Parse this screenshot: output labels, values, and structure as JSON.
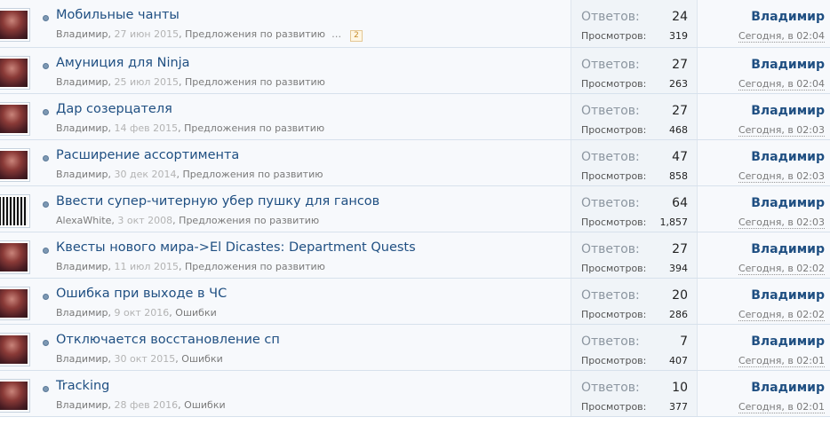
{
  "threads": [
    {
      "title": "Мобильные чанты",
      "author": "Владимир",
      "date": "27 июн 2015",
      "forum": "Предложения по развитию",
      "pages": "2",
      "replies_label": "Ответов:",
      "replies": "24",
      "views_label": "Просмотров:",
      "views": "319",
      "last_user": "Владимир",
      "last_time": "Сегодня, в 02:04"
    },
    {
      "title": "Амуниция для Ninja",
      "author": "Владимир",
      "date": "25 июл 2015",
      "forum": "Предложения по развитию",
      "replies_label": "Ответов:",
      "replies": "27",
      "views_label": "Просмотров:",
      "views": "263",
      "last_user": "Владимир",
      "last_time": "Сегодня, в 02:04"
    },
    {
      "title": "Дар созерцателя",
      "author": "Владимир",
      "date": "14 фев 2015",
      "forum": "Предложения по развитию",
      "replies_label": "Ответов:",
      "replies": "27",
      "views_label": "Просмотров:",
      "views": "468",
      "last_user": "Владимир",
      "last_time": "Сегодня, в 02:03"
    },
    {
      "title": "Расширение ассортимента",
      "author": "Владимир",
      "date": "30 дек 2014",
      "forum": "Предложения по развитию",
      "replies_label": "Ответов:",
      "replies": "47",
      "views_label": "Просмотров:",
      "views": "858",
      "last_user": "Владимир",
      "last_time": "Сегодня, в 02:03"
    },
    {
      "title": "Ввести супер-читерную убер пушку для гансов",
      "author": "AlexaWhite",
      "date": "3 окт 2008",
      "forum": "Предложения по развитию",
      "replies_label": "Ответов:",
      "replies": "64",
      "views_label": "Просмотров:",
      "views": "1,857",
      "last_user": "Владимир",
      "last_time": "Сегодня, в 02:03",
      "avatar": "alt"
    },
    {
      "title": "Квесты нового мира->El Dicastes: Department Quests",
      "author": "Владимир",
      "date": "11 июл 2015",
      "forum": "Предложения по развитию",
      "replies_label": "Ответов:",
      "replies": "27",
      "views_label": "Просмотров:",
      "views": "394",
      "last_user": "Владимир",
      "last_time": "Сегодня, в 02:02"
    },
    {
      "title": "Ошибка при выходе в ЧС",
      "author": "Владимир",
      "date": "9 окт 2016",
      "forum": "Ошибки",
      "replies_label": "Ответов:",
      "replies": "20",
      "views_label": "Просмотров:",
      "views": "286",
      "last_user": "Владимир",
      "last_time": "Сегодня, в 02:02"
    },
    {
      "title": "Отключается восстановление сп",
      "author": "Владимир",
      "date": "30 окт 2015",
      "forum": "Ошибки",
      "replies_label": "Ответов:",
      "replies": "7",
      "views_label": "Просмотров:",
      "views": "407",
      "last_user": "Владимир",
      "last_time": "Сегодня, в 02:01"
    },
    {
      "title": "Tracking",
      "author": "Владимир",
      "date": "28 фев 2016",
      "forum": "Ошибки",
      "replies_label": "Ответов:",
      "replies": "10",
      "views_label": "Просмотров:",
      "views": "377",
      "last_user": "Владимир",
      "last_time": "Сегодня, в 02:01"
    }
  ]
}
